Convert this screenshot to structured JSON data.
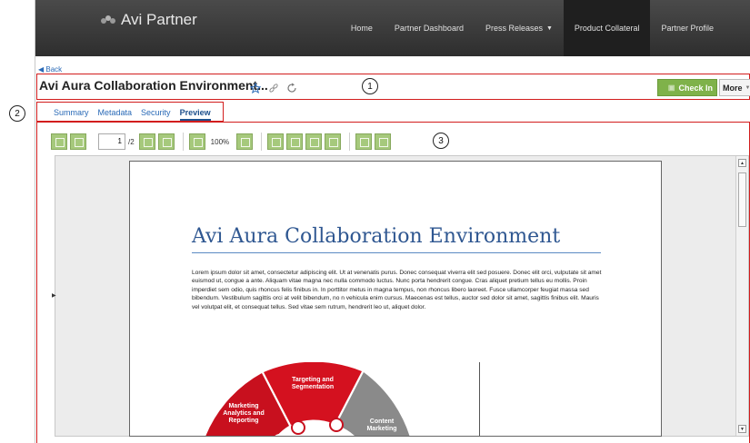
{
  "header": {
    "brand": "Avi Partner",
    "nav": [
      {
        "label": "Home"
      },
      {
        "label": "Partner Dashboard"
      },
      {
        "label": "Press Releases",
        "dropdown": true
      },
      {
        "label": "Product Collateral",
        "active": true
      },
      {
        "label": "Partner Profile"
      }
    ]
  },
  "back_label": "Back",
  "document": {
    "title": "Avi Aura Collaboration Environment...",
    "checkin_label": "Check In",
    "more_label": "More"
  },
  "callouts": [
    "1",
    "2",
    "3"
  ],
  "tabs": [
    {
      "label": "Summary"
    },
    {
      "label": "Metadata"
    },
    {
      "label": "Security"
    },
    {
      "label": "Preview",
      "active": true
    }
  ],
  "toolbar": {
    "page_current": "1",
    "page_total": "/2",
    "zoom": "100%"
  },
  "preview": {
    "heading": "Avi Aura Collaboration Environment",
    "body": "Lorem ipsum dolor sit amet, consectetur adipiscing elit. Ut at venenatis purus. Donec consequat viverra elit sed posuere. Donec elit orci, vulputate sit amet euismod ut, congue a ante. Aliquam vitae magna nec nulla commodo luctus. Nunc porta hendrerit congue. Cras aliquet pretium tellus eu mollis. Proin imperdiet sem odio, quis rhoncus felis finibus in. In porttitor metus in magna tempus, non rhoncus libero laoreet. Fusce ullamcorper feugiat massa sed bibendum. Vestibulum sagittis orci at velit bibendum, no n vehicula enim cursus. Maecenas est tellus, auctor sed dolor sit amet, sagittis finibus elit. Mauris vel volutpat elit, et consequat tellus. Sed vitae sem rutrum, hendrerit leo ut, aliquet dolor.",
    "graphic_labels": {
      "seg1": "Targeting and Segmentation",
      "seg2": "Marketing Analytics and Reporting",
      "seg3": "Content Marketing"
    }
  },
  "colors": {
    "header_bg": "#3a3a3a",
    "accent_green": "#7fb24a",
    "callout_border": "#d21d1d",
    "link_blue": "#2a6ab7",
    "heading_blue": "#2f5791"
  }
}
